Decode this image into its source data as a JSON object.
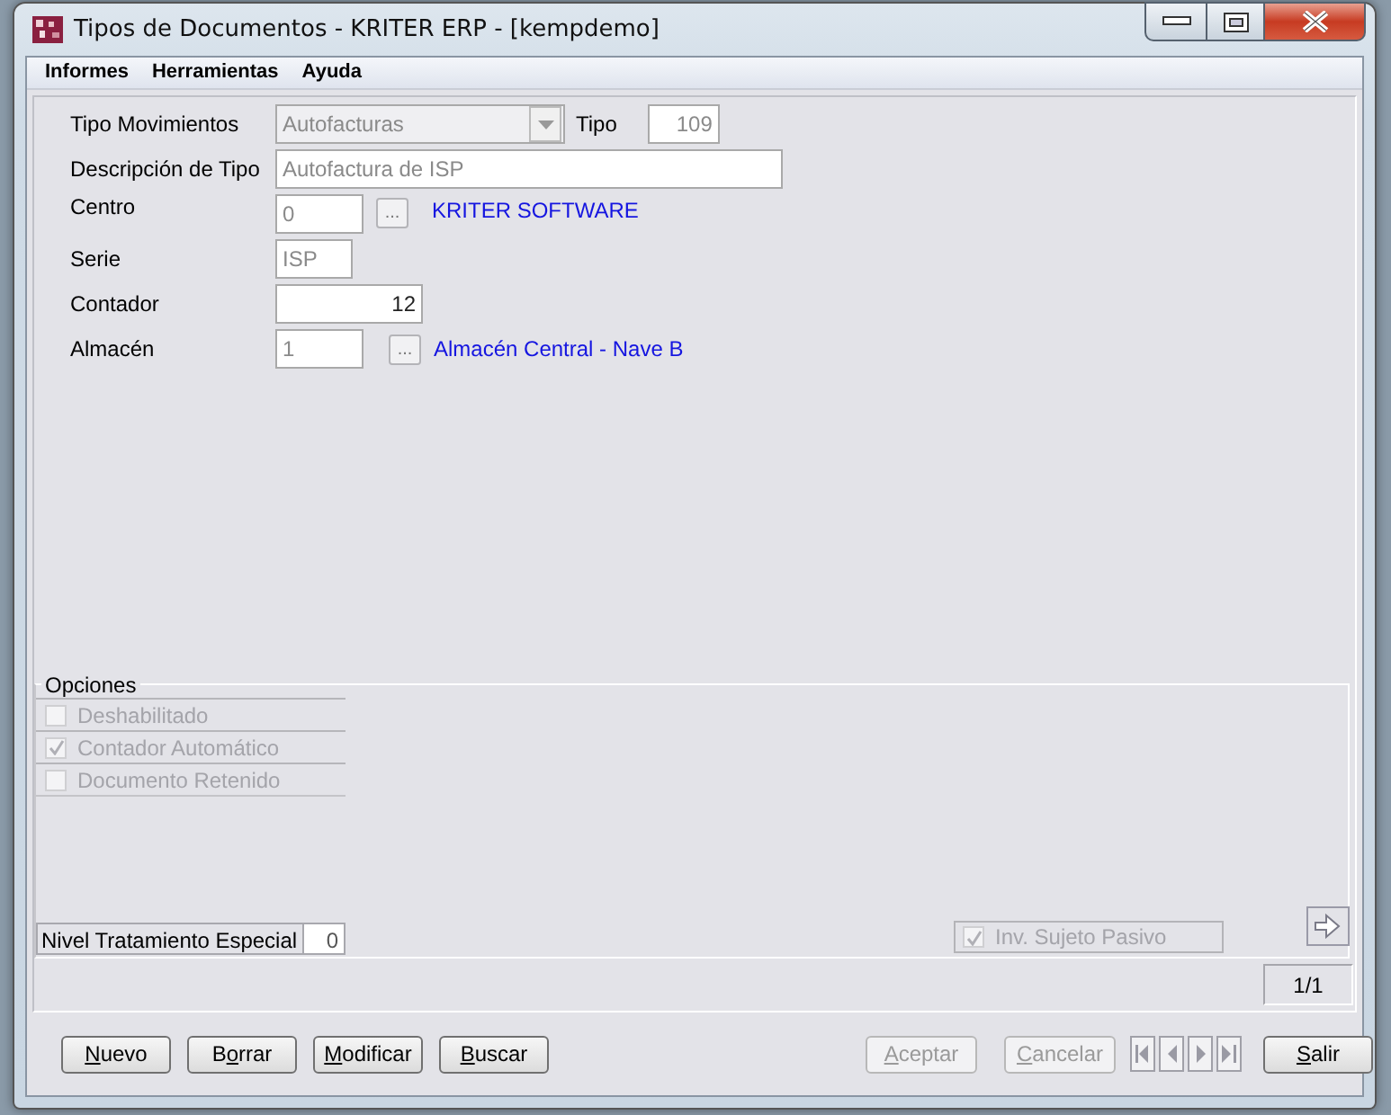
{
  "window": {
    "title": "Tipos de Documentos - KRITER ERP - [kempdemo]"
  },
  "menu": [
    {
      "label": "Informes"
    },
    {
      "label": "Herramientas"
    },
    {
      "label": "Ayuda"
    }
  ],
  "fields": [
    {
      "kind": "combo",
      "label": "Tipo Movimientos",
      "value": "Autofacturas",
      "disabled": true,
      "extra": {
        "label": "Tipo",
        "value": "109",
        "disabled": true
      }
    },
    {
      "kind": "text",
      "label": "Descripción de Tipo",
      "value": "Autofactura de ISP",
      "disabled": true
    },
    {
      "kind": "lookup",
      "label": "Centro",
      "value": "0",
      "disabled": true,
      "button_label": "...",
      "description": "KRITER SOFTWARE"
    },
    {
      "kind": "short",
      "label": "Serie",
      "value": "ISP",
      "disabled": true
    },
    {
      "kind": "number",
      "label": "Contador",
      "value": "12",
      "disabled": false
    },
    {
      "kind": "lookup",
      "label": "Almacén",
      "value": "1",
      "disabled": true,
      "button_label": "...",
      "description": "Almacén Central - Nave B"
    }
  ],
  "options": {
    "title": "Opciones",
    "items": [
      {
        "label": "Deshabilitado",
        "checked": false,
        "disabled": true
      },
      {
        "label": "Contador Automático",
        "checked": true,
        "disabled": true
      },
      {
        "label": "Documento Retenido",
        "checked": false,
        "disabled": true
      }
    ],
    "level_field": {
      "label": "Nivel Tratamiento Especial",
      "value": "0"
    },
    "side_check": {
      "label": "Inv. Sujeto Pasivo",
      "checked": true,
      "disabled": true
    }
  },
  "record_counter": "1/1",
  "buttons_left": [
    {
      "key": "N",
      "after": "uevo",
      "disabled": false
    },
    {
      "before": "B",
      "key": "o",
      "after": "rrar",
      "disabled": false
    },
    {
      "key": "M",
      "after": "odificar",
      "disabled": false
    },
    {
      "key": "B",
      "after": "uscar",
      "disabled": false
    }
  ],
  "buttons_right": [
    {
      "key": "A",
      "after": "ceptar",
      "disabled": true
    },
    {
      "key": "C",
      "after": "ancelar",
      "disabled": true
    }
  ],
  "exit_button": {
    "key": "S",
    "after": "alir",
    "disabled": false
  }
}
